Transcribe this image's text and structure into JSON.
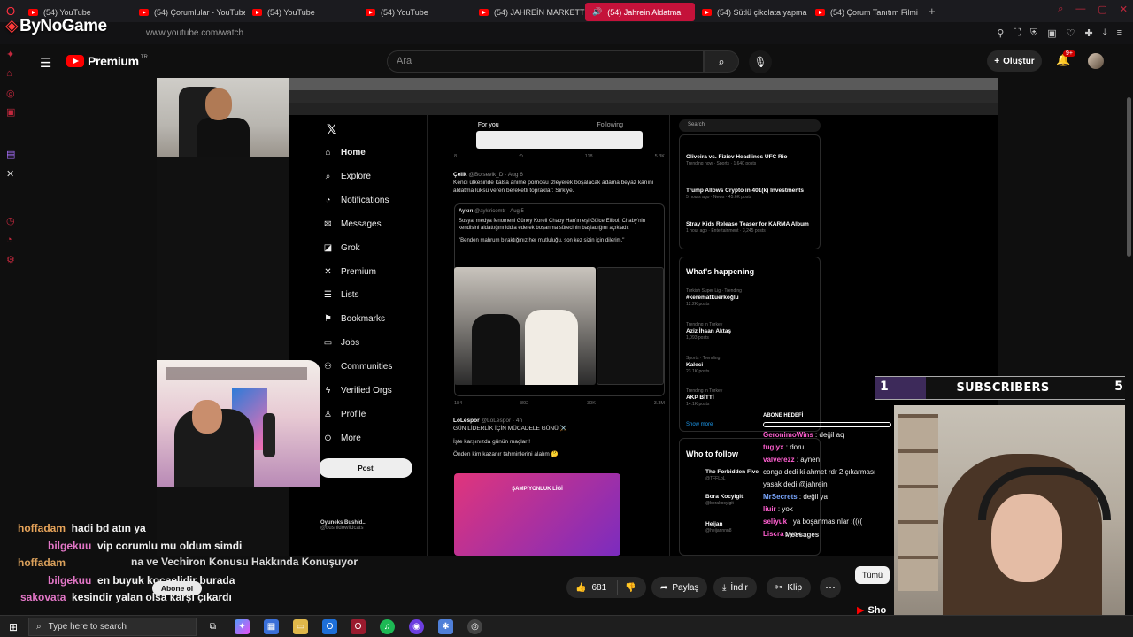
{
  "browser": {
    "tabs": [
      {
        "label": "(54) YouTube",
        "active": false
      },
      {
        "label": "(54) Çorumlular - YouTube",
        "active": false
      },
      {
        "label": "(54) YouTube",
        "active": false
      },
      {
        "label": "(54) YouTube",
        "active": false
      },
      {
        "label": "(54) JAHREİN MARKETTE",
        "active": false
      },
      {
        "label": "(54) Jahrein Aldatma",
        "active": true
      },
      {
        "label": "(54) Sütlü çikolata yapma",
        "active": false
      },
      {
        "label": "(54) Çorum Tanıtım Filmi",
        "active": false
      }
    ],
    "url": "www.youtube.com/watch",
    "overlay_brand": "ByNoGame"
  },
  "youtube": {
    "logo_text": "Premium",
    "logo_sup": "TR",
    "search_placeholder": "Ara",
    "create_label": "Oluştur",
    "notif_badge": "9+"
  },
  "x_page": {
    "nav": [
      "Home",
      "Explore",
      "Notifications",
      "Messages",
      "Grok",
      "Premium",
      "Lists",
      "Bookmarks",
      "Jobs",
      "Communities",
      "Verified Orgs",
      "Profile",
      "More"
    ],
    "post_label": "Post",
    "bottom_user": {
      "name": "Oyuneks Bushid...",
      "handle": "@bushidowildcats"
    },
    "feed_tabs": [
      "For you",
      "Following"
    ],
    "first_stats": {
      "replies": "8",
      "likes": "118",
      "views": "5.3K"
    },
    "tweet1": {
      "name": "Çelik",
      "handle": "@Bolsevik_D · Aug 6",
      "text": "Kendi ülkesinde kalsa anime pornosu izleyerek boşalacak adama beyaz kanını aldatma lüksü veren bereketli topraklar: Sirkiye.",
      "quote_name": "Aykırı",
      "quote_handle": "@aykiricomtr · Aug 5",
      "quote_text": "Sosyal medya fenomeni Güney Koreli Chaby Han'ın eşi Gülce Elibol, Chaby'nin kendisini aldattığını iddia ederek boşanma sürecinin başladığını açıkladı:",
      "quote_quote": "\"Benden mahrum bıraktığınız her mutluluğu, son kez sizin için dilerim.\"",
      "stats": {
        "replies": "184",
        "reposts": "892",
        "likes": "30K",
        "views": "3.3M"
      }
    },
    "tweet2": {
      "name": "LoLespor",
      "handle": "@LoLespor · 4h",
      "text": "GÜN LİDERLİK İÇİN MÜCADELE GÜNÜ ⚔️",
      "line2": "İşte karşınızda günün maçları!",
      "line3": "Önden kim kazanır tahminlerini alalım 🤔",
      "card_text": "ŞAMPİYONLUK LİGİ"
    },
    "search_label": "Search",
    "trends_top": [
      {
        "title": "Oliveira vs. Fiziev Headlines UFC Rio",
        "meta": "Trending now · Sports · 1,640 posts"
      },
      {
        "title": "Trump Allows Crypto in 401(k) Investments",
        "meta": "5 hours ago · News · 45.6K posts"
      },
      {
        "title": "Stray Kids Release Teaser for KARMA Album",
        "meta": "1 hour ago · Entertainment · 3,245 posts"
      }
    ],
    "whats_happening_title": "What's happening",
    "trends": [
      {
        "cat": "Turkish Super Lig · Trending",
        "title": "#kerematkuerkoğlu",
        "posts": "12.2K posts"
      },
      {
        "cat": "Trending in Turkey",
        "title": "Aziz İhsan Aktaş",
        "posts": "1,093 posts"
      },
      {
        "cat": "Sports · Trending",
        "title": "Kaleci",
        "posts": "23.1K posts"
      },
      {
        "cat": "Trending in Turkey",
        "title": "AKP BİTTİ",
        "posts": "14.1K posts"
      }
    ],
    "show_more": "Show more",
    "who_to_follow_title": "Who to follow",
    "follow": [
      {
        "name": "The Forbidden Five",
        "handle": "@TFFLoL"
      },
      {
        "name": "Bora Kocyigit",
        "handle": "@borakocyigit"
      },
      {
        "name": "Heijan",
        "handle": "@heijannnn8"
      }
    ],
    "messages_label": "Messages"
  },
  "subs_bar": {
    "current": "1",
    "label": "SUBSCRIBERS",
    "goal": "5",
    "progress": 0.2
  },
  "stream_chat": {
    "goal_title": "ABONE HEDEFİ",
    "messages": [
      {
        "user": "GeronimoWins",
        "text": "değil aq",
        "color": "#ff5fd0"
      },
      {
        "user": "tugiyx",
        "text": "doru",
        "color": "#ff5fd0"
      },
      {
        "user": "valverezz",
        "text": "aynen",
        "color": "#ff5fd0"
      },
      {
        "user": "",
        "text": "conga dedi ki ahmet rdr 2 çıkarması yasak dedi @jahrein",
        "color": "#ff5fd0"
      },
      {
        "user": "MrSecrets",
        "text": "değil ya",
        "color": "#7aa7ff"
      },
      {
        "user": "liuir",
        "text": "yok",
        "color": "#ff5fd0"
      },
      {
        "user": "seliyuk",
        "text": "ya boşanmasınlar :((((",
        "color": "#ff5fd0"
      },
      {
        "user": "Liscra",
        "text": "yok",
        "color": "#ff5fd0"
      }
    ]
  },
  "bottom_chat": [
    {
      "user": "hoffadam",
      "text": "hadi bd atın ya"
    },
    {
      "user": "bilgekuu",
      "text": "vip corumlu mu oldum simdi"
    },
    {
      "user": "hoffadam",
      "text": ""
    },
    {
      "user": "bilgekuu",
      "text": "en buyuk kocaelidir burada"
    },
    {
      "user": "sakovata",
      "text": "kesindir yalan olsa karşı çıkardı"
    }
  ],
  "video_title_fragment": "na ve Vechiron Konusu Hakkında Konuşuyor",
  "actions": {
    "subscribe": "Abone ol",
    "likes": "681",
    "share": "Paylaş",
    "download": "İndir",
    "clip": "Klip",
    "all_chip": "Tümü",
    "shorts": "Sho"
  },
  "taskbar": {
    "search_placeholder": "Type here to search"
  },
  "colors": {
    "accent": "#c4123a",
    "yt_red": "#ff0000",
    "link": "#1d9bf0"
  }
}
